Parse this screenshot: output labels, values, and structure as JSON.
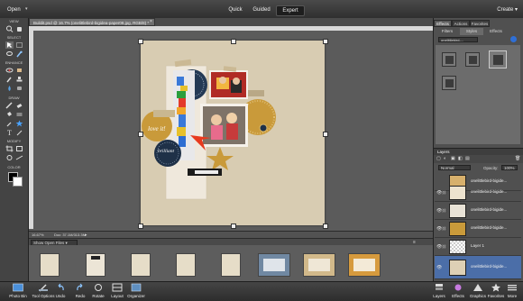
{
  "app": {
    "open_label": "Open",
    "modes": [
      "Quick",
      "Guided",
      "Expert"
    ],
    "active_mode": "Expert",
    "create_label": "Create"
  },
  "toolbar": {
    "sections": [
      "VIEW",
      "SELECT",
      "ENHANCE",
      "DRAW",
      "MODIFY",
      "COLOR"
    ]
  },
  "document": {
    "tab_title": "Buildit.psd @ 16.7% (onelittlebird-bigidea-paper08.jpg, RGB/8) *",
    "zoom": "16.67%",
    "doc_size": "Doc: 37.1M/313.3M",
    "page_text": {
      "love_it": "love it!",
      "brilliant": "brilliant"
    }
  },
  "panel": {
    "tabs": [
      "Effects",
      "Actions",
      "Favorites"
    ],
    "active_tab": "Effects",
    "subtabs": [
      "Filters",
      "Styles",
      "Effects"
    ],
    "active_subtab": "Styles",
    "style_dropdown": "onelittlebird-...",
    "layers_title": "Layers",
    "blend_mode": "Normal",
    "opacity_label": "Opacity:",
    "opacity_value": "100%",
    "layers": [
      {
        "name": "onelittlebird-bigide...",
        "selected": false
      },
      {
        "name": "onelittlebird-bigide...",
        "selected": false
      },
      {
        "name": "onelittlebird-bigide...",
        "selected": false
      },
      {
        "name": "onelittlebird-bigide...",
        "selected": false
      },
      {
        "name": "Layer 1",
        "selected": false
      },
      {
        "name": "onelittlebird-bigide...",
        "selected": true
      }
    ]
  },
  "bin": {
    "dropdown": "Show Open Files"
  },
  "taskbar": {
    "left": [
      "Photo Bin",
      "Tool Options",
      "Undo",
      "Redo",
      "Rotate",
      "Layout",
      "Organizer"
    ],
    "right": [
      "Layers",
      "Effects",
      "Graphics",
      "Favorites",
      "More"
    ]
  },
  "colors": {
    "accent": "#2f6fd6",
    "page": "#d8ccb2",
    "navy": "#1f3148",
    "mustard": "#c99a3a",
    "red_arrow": "#e83a1e"
  }
}
